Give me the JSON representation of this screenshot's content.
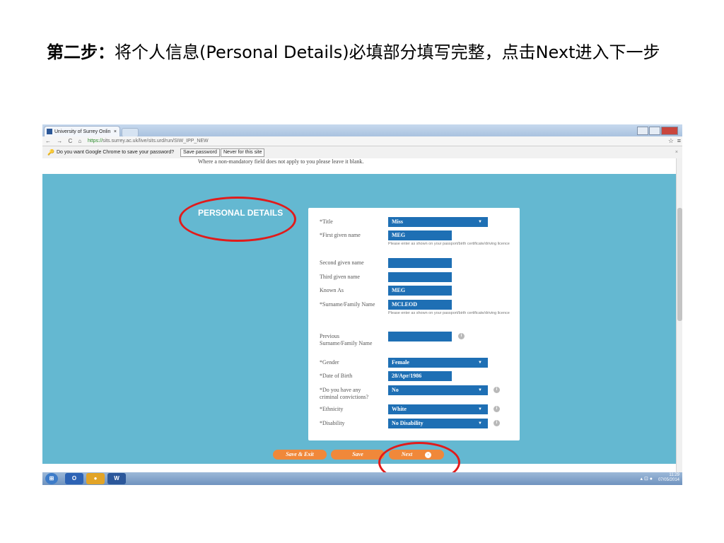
{
  "slide": {
    "step_label": "第二步：",
    "instruction": "将个人信息(Personal Details)必填部分填写完整，点击Next进入下一步"
  },
  "browser": {
    "tab_title": "University of Surrey Onlin",
    "tab_close": "×",
    "url_scheme": "https://",
    "url_rest": "sits.surrey.ac.uk/live/sits.urd/run/SIW_IPP_NEW",
    "nav_glyphs": "← → C ⌂",
    "star_glyph": "☆",
    "menu_glyph": "≡"
  },
  "password_bar": {
    "message": "Do you want Google Chrome to save your password?",
    "save_label": "Save password",
    "never_label": "Never for this site",
    "close_glyph": "×"
  },
  "page": {
    "note": "Where a non-mandatory field does not apply to you please leave it blank.",
    "section_heading": "PERSONAL DETAILS"
  },
  "form": {
    "title": {
      "label": "*Title",
      "value": "Miss"
    },
    "first_name": {
      "label": "*First given name",
      "value": "MEG",
      "hint": "Please enter as shown on your passport/birth certificate/driving licence"
    },
    "second_name": {
      "label": "Second given name",
      "value": ""
    },
    "third_name": {
      "label": "Third given name",
      "value": ""
    },
    "known_as": {
      "label": "Known As",
      "value": "MEG"
    },
    "surname": {
      "label": "*Surname/Family Name",
      "value": "MCLEOD",
      "hint": "Please enter as shown on your passport/birth certificate/driving licence"
    },
    "previous_surname": {
      "label": "Previous Surname/Family Name",
      "value": ""
    },
    "gender": {
      "label": "*Gender",
      "value": "Female"
    },
    "dob": {
      "label": "*Date of Birth",
      "value": "28/Apr/1986"
    },
    "convictions": {
      "label": "*Do you have any criminal convictions?",
      "value": "No"
    },
    "ethnicity": {
      "label": "*Ethnicity",
      "value": "White"
    },
    "disability": {
      "label": "*Disability",
      "value": "No Disability"
    },
    "caret": "▼",
    "info_glyph": "i"
  },
  "buttons": {
    "save_exit": "Save & Exit",
    "save": "Save",
    "next": "Next",
    "next_arrow": "›"
  },
  "taskbar": {
    "apps": [
      "O",
      "W"
    ],
    "time": "11:29",
    "date": "07/05/2014"
  },
  "colors": {
    "teal": "#64b8d1",
    "field_blue": "#1e6fb4",
    "orange": "#f0883a",
    "highlight_ring": "#e11b1b"
  }
}
